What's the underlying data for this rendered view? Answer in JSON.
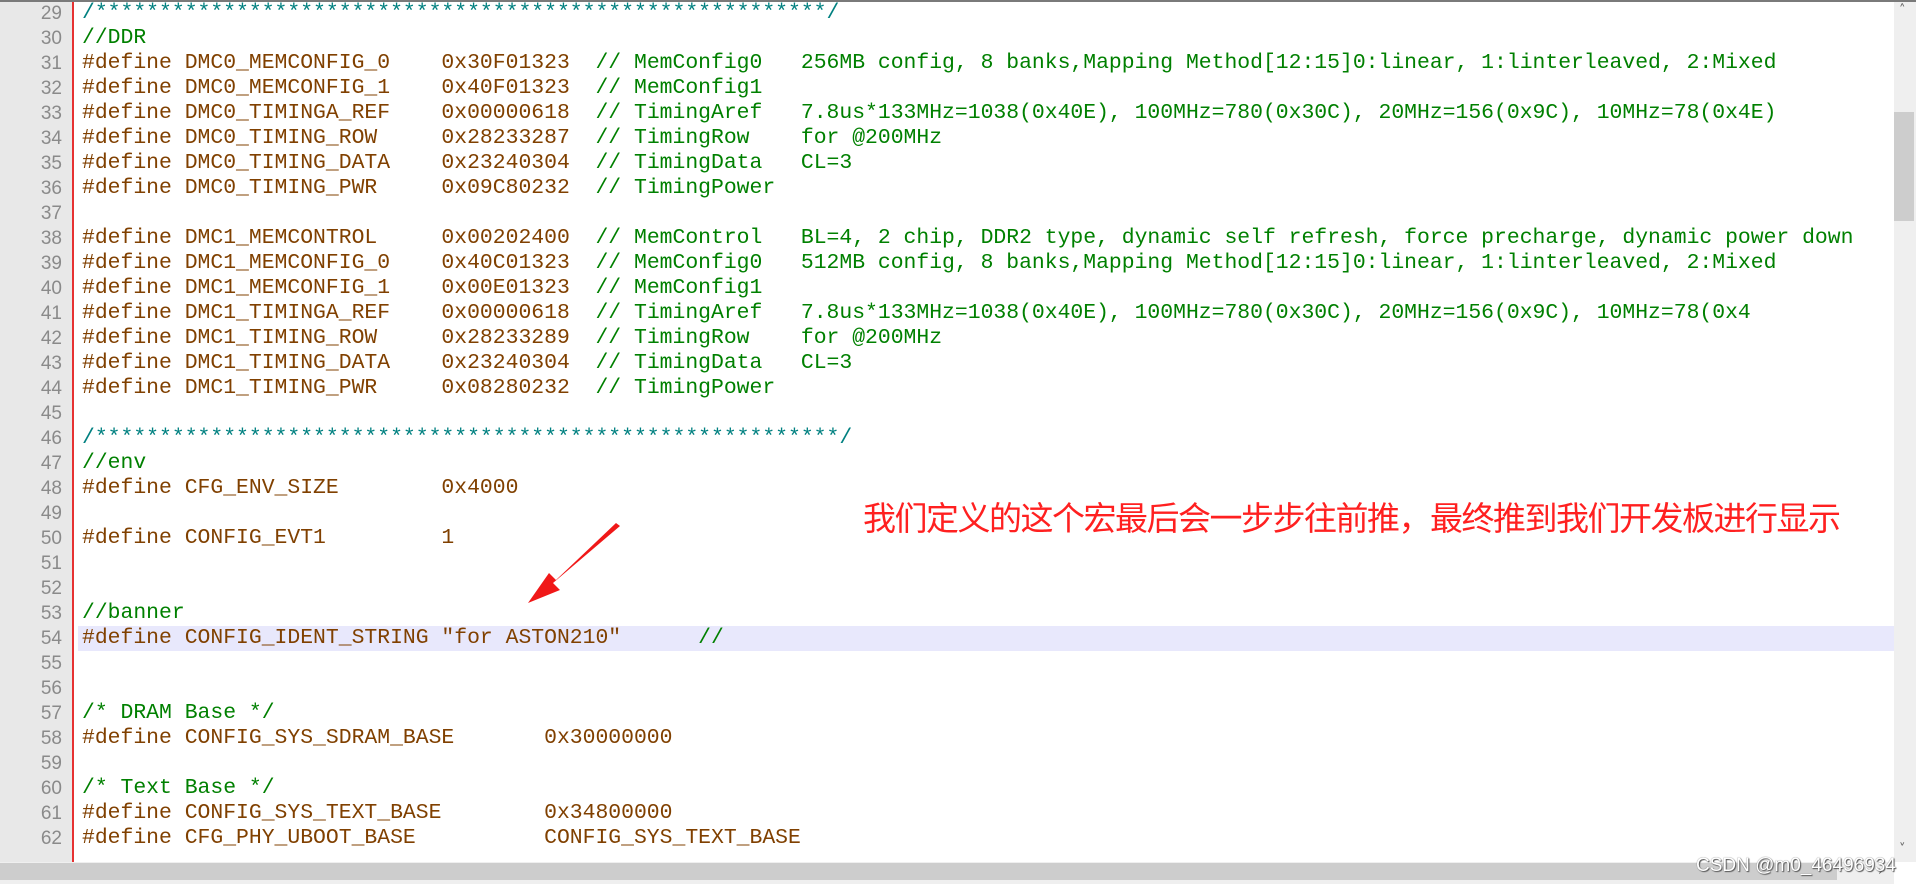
{
  "editor": {
    "highlighted_line": 54,
    "colors": {
      "code": "#804000",
      "comment": "#008000",
      "block_comment": "#008080",
      "current_line": "#e8e8fc",
      "gutter_edge": "#e63232"
    },
    "lines": [
      {
        "n": "29",
        "block": "/*********************************************************/"
      },
      {
        "n": "30",
        "cm": "//DDR"
      },
      {
        "n": "31",
        "code": "#define DMC0_MEMCONFIG_0    0x30F01323  ",
        "cm": "// MemConfig0   256MB config, 8 banks,Mapping Method[12:15]0:linear, 1:linterleaved, 2:Mixed"
      },
      {
        "n": "32",
        "code": "#define DMC0_MEMCONFIG_1    0x40F01323  ",
        "cm": "// MemConfig1"
      },
      {
        "n": "33",
        "code": "#define DMC0_TIMINGA_REF    0x00000618  ",
        "cm": "// TimingAref   7.8us*133MHz=1038(0x40E), 100MHz=780(0x30C), 20MHz=156(0x9C), 10MHz=78(0x4E)"
      },
      {
        "n": "34",
        "code": "#define DMC0_TIMING_ROW     0x28233287  ",
        "cm": "// TimingRow    for @200MHz"
      },
      {
        "n": "35",
        "code": "#define DMC0_TIMING_DATA    0x23240304  ",
        "cm": "// TimingData   CL=3"
      },
      {
        "n": "36",
        "code": "#define DMC0_TIMING_PWR     0x09C80232  ",
        "cm": "// TimingPower"
      },
      {
        "n": "37"
      },
      {
        "n": "38",
        "code": "#define DMC1_MEMCONTROL     0x00202400  ",
        "cm": "// MemControl   BL=4, 2 chip, DDR2 type, dynamic self refresh, force precharge, dynamic power down"
      },
      {
        "n": "39",
        "code": "#define DMC1_MEMCONFIG_0    0x40C01323  ",
        "cm": "// MemConfig0   512MB config, 8 banks,Mapping Method[12:15]0:linear, 1:linterleaved, 2:Mixed"
      },
      {
        "n": "40",
        "code": "#define DMC1_MEMCONFIG_1    0x00E01323  ",
        "cm": "// MemConfig1"
      },
      {
        "n": "41",
        "code": "#define DMC1_TIMINGA_REF    0x00000618  ",
        "cm": "// TimingAref   7.8us*133MHz=1038(0x40E), 100MHz=780(0x30C), 20MHz=156(0x9C), 10MHz=78(0x4"
      },
      {
        "n": "42",
        "code": "#define DMC1_TIMING_ROW     0x28233289  ",
        "cm": "// TimingRow    for @200MHz"
      },
      {
        "n": "43",
        "code": "#define DMC1_TIMING_DATA    0x23240304  ",
        "cm": "// TimingData   CL=3"
      },
      {
        "n": "44",
        "code": "#define DMC1_TIMING_PWR     0x08280232  ",
        "cm": "// TimingPower"
      },
      {
        "n": "45"
      },
      {
        "n": "46",
        "block": "/**********************************************************/"
      },
      {
        "n": "47",
        "cm": "//env"
      },
      {
        "n": "48",
        "code": "#define CFG_ENV_SIZE        0x4000"
      },
      {
        "n": "49"
      },
      {
        "n": "50",
        "code": "#define CONFIG_EVT1         1"
      },
      {
        "n": "51"
      },
      {
        "n": "52"
      },
      {
        "n": "53",
        "cm": "//banner"
      },
      {
        "n": "54",
        "code": "#define CONFIG_IDENT_STRING \"for ASTON210\"      ",
        "cm": "//"
      },
      {
        "n": "55"
      },
      {
        "n": "56"
      },
      {
        "n": "57",
        "cm": "/* DRAM Base */"
      },
      {
        "n": "58",
        "code": "#define CONFIG_SYS_SDRAM_BASE       0x30000000"
      },
      {
        "n": "59"
      },
      {
        "n": "60",
        "cm": "/* Text Base */"
      },
      {
        "n": "61",
        "code": "#define CONFIG_SYS_TEXT_BASE        0x34800000"
      },
      {
        "n": "62",
        "code": "#define CFG_PHY_UBOOT_BASE          CONFIG_SYS_TEXT_BASE"
      }
    ]
  },
  "annotation": {
    "text": "我们定义的这个宏最后会一步步往前推，最终推到我们开发板进行显示",
    "color": "#ff2020",
    "icon": "red-arrow-icon"
  },
  "scrollbars": {
    "up_icon": "chevron-up-icon",
    "down_icon": "chevron-down-icon",
    "right_icon": "chevron-right-icon"
  },
  "watermark": "CSDN @m0_46496934"
}
